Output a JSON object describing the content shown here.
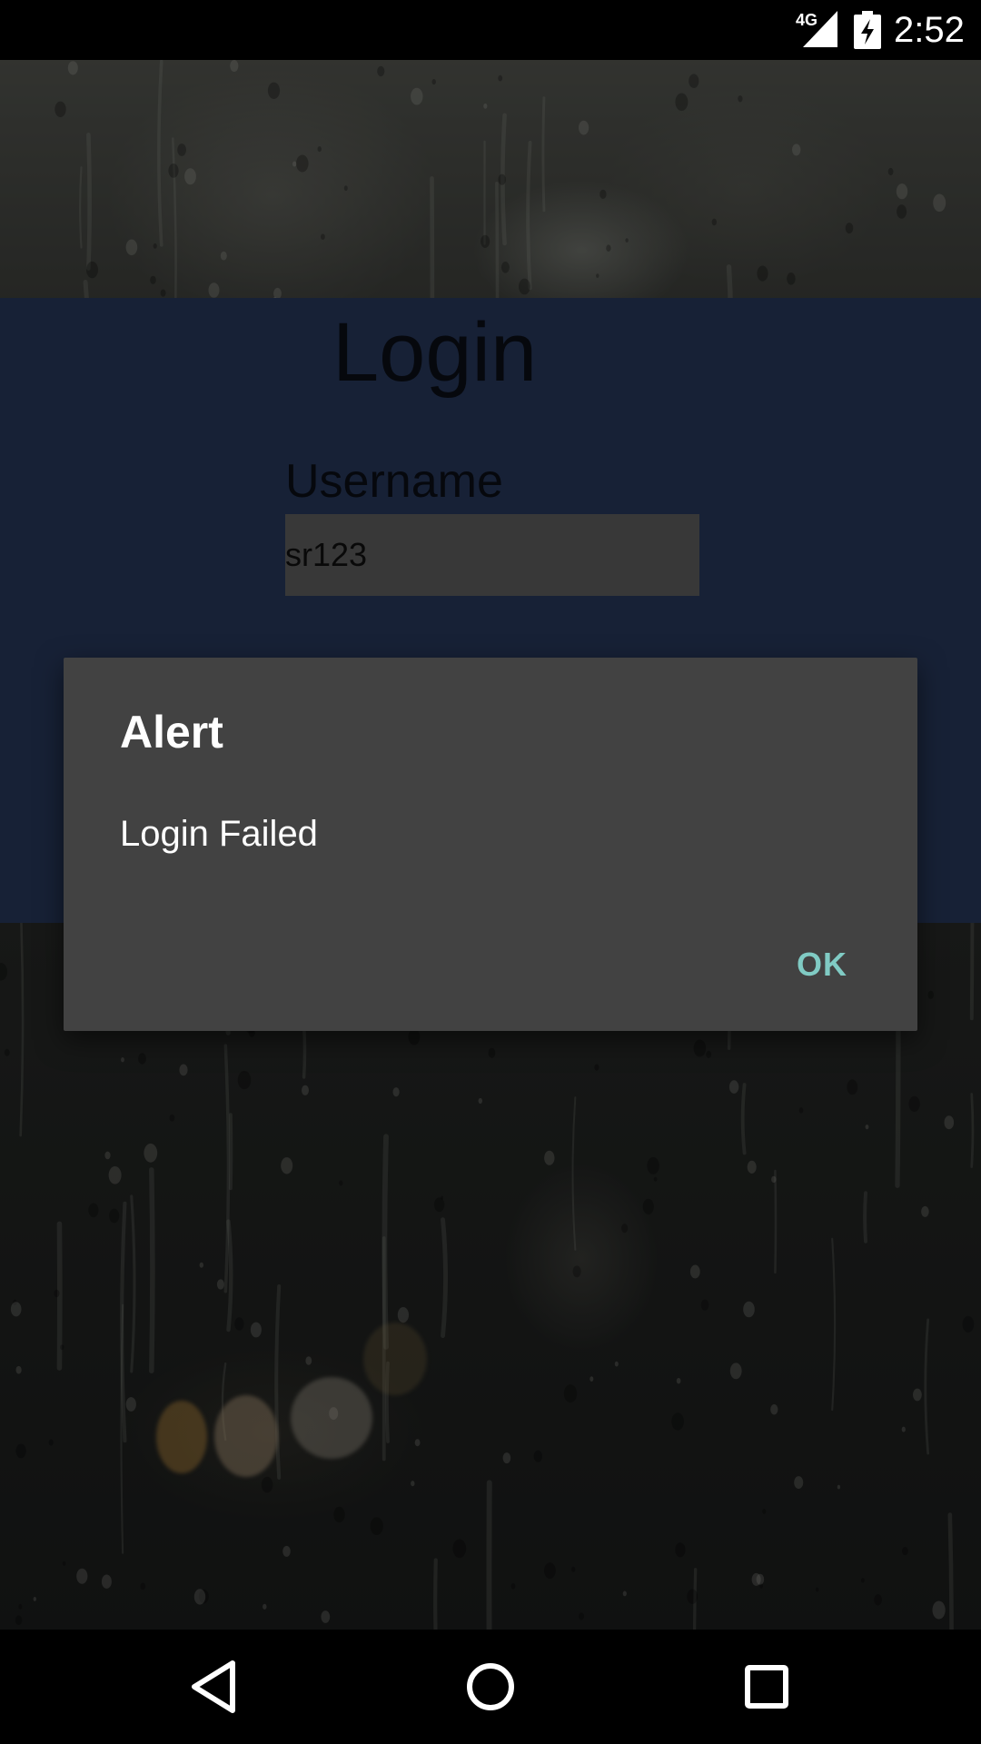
{
  "status_bar": {
    "network_label": "4G",
    "time": "2:52",
    "icons": [
      "signal-icon",
      "battery-charging-icon"
    ]
  },
  "login": {
    "title": "Login",
    "username_label": "Username",
    "username_value": "sr123"
  },
  "alert": {
    "title": "Alert",
    "message": "Login Failed",
    "ok_label": "OK"
  },
  "nav_bar": {
    "icons": [
      "back-icon",
      "home-icon",
      "recents-icon"
    ]
  },
  "colors": {
    "panel": "#2b3d63",
    "dialog": "#424242",
    "ok_accent": "#80cbc4"
  }
}
